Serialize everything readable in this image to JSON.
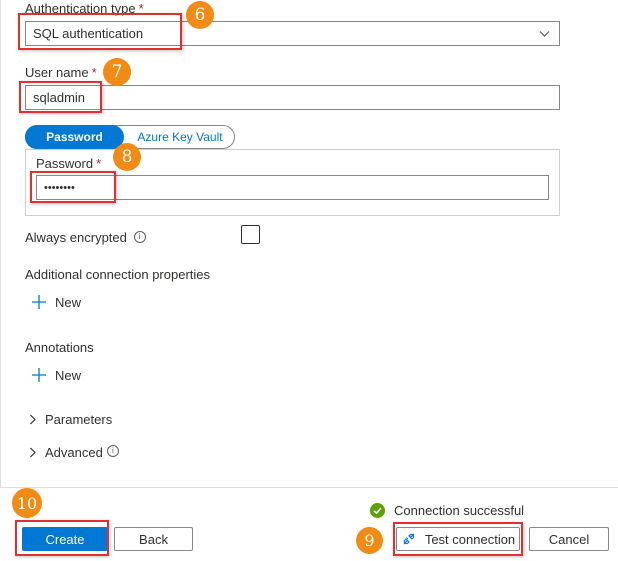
{
  "auth_type": {
    "label": "Authentication type",
    "required": "*",
    "value": "SQL authentication"
  },
  "user_name": {
    "label": "User name",
    "required": "*",
    "value": "sqladmin"
  },
  "password_toggle": {
    "options": [
      "Password",
      "Azure Key Vault"
    ],
    "selected": "Password"
  },
  "password": {
    "label": "Password",
    "required": "*",
    "value": "••••••••"
  },
  "always_encrypted": {
    "label": "Always encrypted",
    "checked": false
  },
  "additional_props": {
    "heading": "Additional connection properties",
    "new_label": "New"
  },
  "annotations": {
    "heading": "Annotations",
    "new_label": "New"
  },
  "sections": {
    "parameters": "Parameters",
    "advanced": "Advanced"
  },
  "footer": {
    "status": "Connection successful",
    "create": "Create",
    "back": "Back",
    "test_connection": "Test connection",
    "cancel": "Cancel"
  },
  "step_badges": {
    "b6": "6",
    "b7": "7",
    "b8": "8",
    "b9": "9",
    "b10": "10"
  },
  "colors": {
    "accent": "#0078d4",
    "badge": "#f28b13",
    "highlight": "#e03030",
    "success": "#57a300"
  }
}
